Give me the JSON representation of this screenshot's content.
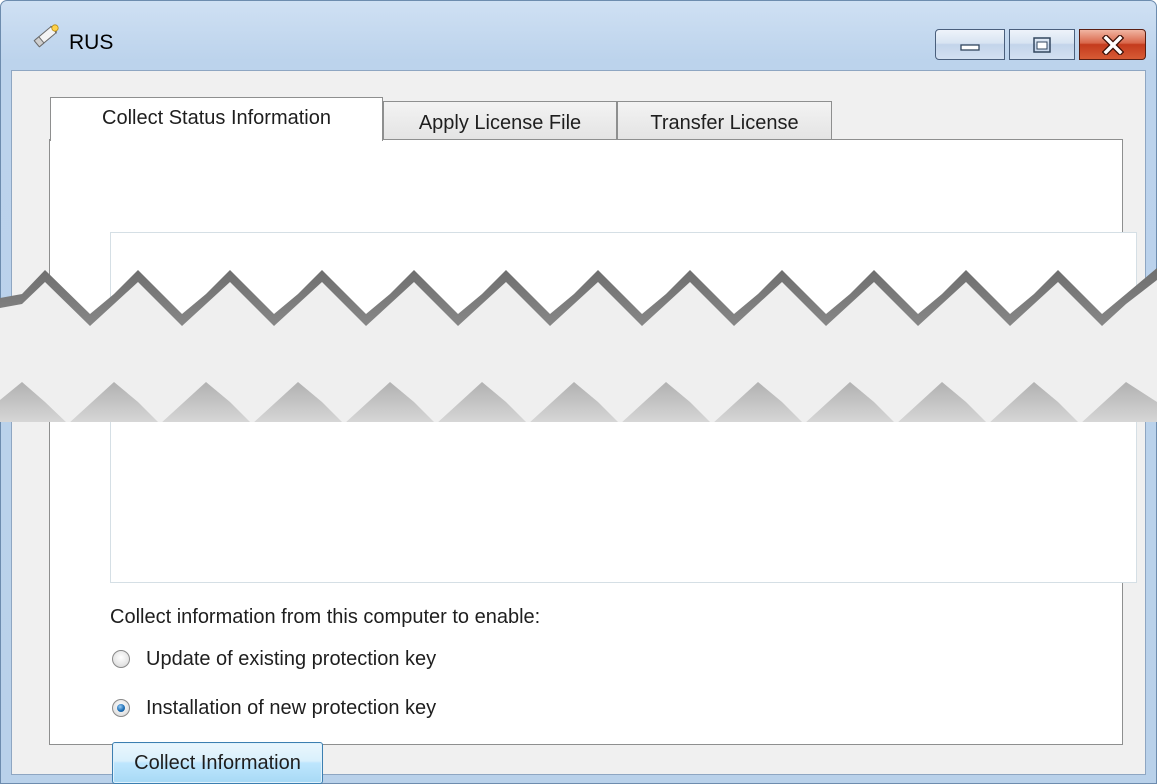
{
  "window": {
    "title": "RUS",
    "app_icon": "key-pencil-icon",
    "controls": {
      "minimize_icon": "minimize-icon",
      "maximize_icon": "maximize-icon",
      "close_icon": "close-icon"
    }
  },
  "tabs": [
    {
      "label": "Collect Status Information",
      "selected": true
    },
    {
      "label": "Apply License File",
      "selected": false
    },
    {
      "label": "Transfer License",
      "selected": false
    }
  ],
  "collect_tab": {
    "prompt": "Collect information from this computer to enable:",
    "options": [
      {
        "label": "Update of existing protection key",
        "checked": false
      },
      {
        "label": "Installation of new protection key",
        "checked": true
      }
    ],
    "collect_button_label": "Collect Information"
  },
  "colors": {
    "frame": "#b9d1ea",
    "close_button": "#c43b1d",
    "radio_selected": "#1d6fb6",
    "button_border": "#3c7fb1"
  }
}
